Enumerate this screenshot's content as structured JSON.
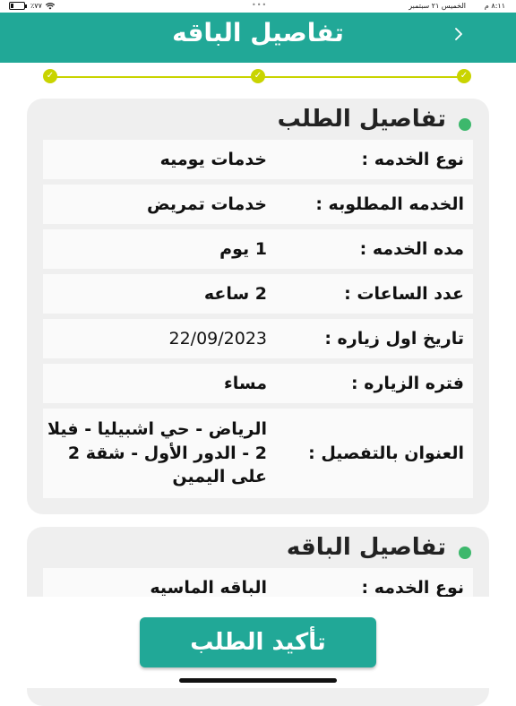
{
  "status_bar": {
    "time": "٨:١١ م",
    "date": "الخميس ٢١ سبتمبر",
    "battery": "٪٧٧"
  },
  "header": {
    "title": "تفاصيل الباقه",
    "back_icon": "chevron-right-icon",
    "color": "#21a897"
  },
  "stepper": {
    "accent": "#c9d400",
    "steps": [
      "check-icon",
      "check-icon",
      "check-icon"
    ]
  },
  "order_details": {
    "title": "تفاصيل الطلب",
    "rows": [
      {
        "label": "نوع الخدمه :",
        "value": "خدمات يوميه"
      },
      {
        "label": "الخدمه المطلوبه :",
        "value": "خدمات تمريض"
      },
      {
        "label": "مده الخدمه  :",
        "value": "1 يوم"
      },
      {
        "label": "عدد الساعات :",
        "value": "2 ساعه"
      },
      {
        "label": "تاريخ اول زياره :",
        "value": "22/09/2023"
      },
      {
        "label": "فتره الزياره :",
        "value": "مساء"
      },
      {
        "label": "العنوان بالتفصيل  :",
        "value": "الرياض - حي اشبيليا - فيلا 2 - الدور الأول - شقة 2 على اليمين"
      }
    ]
  },
  "package_details": {
    "title": "تفاصيل الباقه",
    "rows": [
      {
        "label": "نوع الخدمه :",
        "value": "الباقه الماسيه"
      }
    ]
  },
  "confirm_button": {
    "label": "تأكيد الطلب"
  },
  "colors": {
    "primary": "#21a897",
    "dot": "#3db86c",
    "step": "#c9d400"
  }
}
